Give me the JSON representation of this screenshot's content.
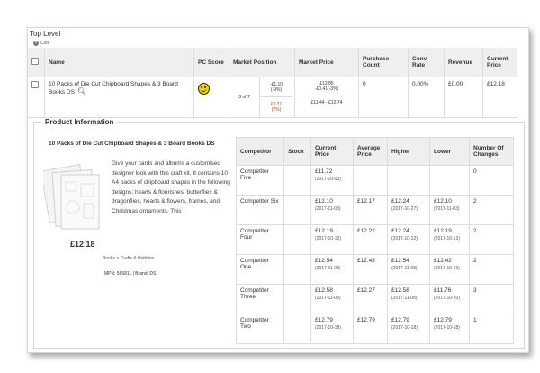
{
  "title": "Top Level",
  "cols_label": "Cols",
  "table": {
    "headers": [
      "Name",
      "PC Score",
      "Market Position",
      "Market Price",
      "Purchase Count",
      "Conv Rate",
      "Revenue",
      "Current Price"
    ],
    "row": {
      "name": "10 Packs of Die Cut Chipboard Shapes & 3 Board Books DS",
      "rank": "3 of 7",
      "up_value": "-£1.10",
      "up_pct": "(-9%)",
      "low_value": "£0.21",
      "low_pct": "(2%)",
      "market_avg": "£12.85",
      "market_diff": "-£0.41(-3%)",
      "market_range": "£11.44 - £12.74",
      "purchase_count": "0",
      "conv_rate": "0.00%",
      "revenue": "£0.00",
      "current_price": "£12.18"
    }
  },
  "product_info": {
    "section_title": "Product Information",
    "name": "10 Packs of Die Cut Chipboard Shapes & 3 Board Books DS",
    "description": "Give your cards and albums a customised designer look with this craft kit. It contains 10 A4 packs of chipboard shapes in the following designs: hearts & flourishes, butterflies & dragonflies, hearts & flowers, frames, and Christmas ornaments. This",
    "price": "£12.18",
    "category": "Books > Crafts & Hobbies",
    "mpn_line": "MPN: 586811 | Brand: DS"
  },
  "competitors": {
    "headers": [
      "Competitor",
      "Stock",
      "Current Price",
      "Average Price",
      "Higher",
      "Lower",
      "Number Of Changes"
    ],
    "rows": [
      {
        "name": "Competitor Five",
        "stock": "",
        "current": "£11.72",
        "current_date": "(2017-10-03)",
        "average": "",
        "higher": "",
        "higher_date": "",
        "lower": "",
        "lower_date": "",
        "changes": "0"
      },
      {
        "name": "Competitor Six",
        "stock": "",
        "current": "£12.10",
        "current_date": "(2017-11-03)",
        "average": "£12.17",
        "higher": "£12.24",
        "higher_date": "(2017-10-27)",
        "lower": "£12.10",
        "lower_date": "(2017-11-03)",
        "changes": "2"
      },
      {
        "name": "Competitor Four",
        "stock": "",
        "current": "£12.19",
        "current_date": "(2017-10-13)",
        "average": "£12.22",
        "higher": "£12.24",
        "higher_date": "(2017-10-12)",
        "lower": "£12.19",
        "lower_date": "(2017-10-13)",
        "changes": "2"
      },
      {
        "name": "Competitor One",
        "stock": "",
        "current": "£12.54",
        "current_date": "(2017-11-08)",
        "average": "£12.48",
        "higher": "£12.54",
        "higher_date": "(2017-11-08)",
        "lower": "£12.42",
        "lower_date": "(2017-10-23)",
        "changes": "2"
      },
      {
        "name": "Competitor Three",
        "stock": "",
        "current": "£12.58",
        "current_date": "(2017-11-08)",
        "average": "£12.27",
        "higher": "£12.58",
        "higher_date": "(2017-11-08)",
        "lower": "£11.76",
        "lower_date": "(2017-10-20)",
        "changes": "3"
      },
      {
        "name": "Competitor Two",
        "stock": "",
        "current": "£12.79",
        "current_date": "(2017-10-18)",
        "average": "£12.79",
        "higher": "£12.79",
        "higher_date": "(2017-10-18)",
        "lower": "£12.79",
        "lower_date": "(2017-10-18)",
        "changes": "1"
      }
    ]
  }
}
